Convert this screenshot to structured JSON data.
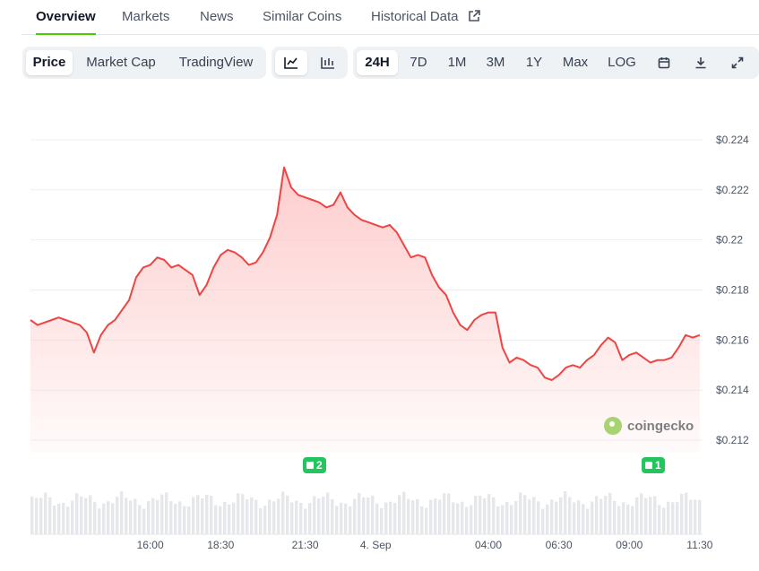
{
  "tabs": [
    {
      "label": "Overview",
      "active": true
    },
    {
      "label": "Markets"
    },
    {
      "label": "News"
    },
    {
      "label": "Similar Coins"
    },
    {
      "label": "Historical Data",
      "external": true
    }
  ],
  "toolbar": {
    "metric_tabs": [
      "Price",
      "Market Cap",
      "TradingView"
    ],
    "metric_selected": "Price",
    "chart_types": [
      "line-chart-icon",
      "candlestick-icon"
    ],
    "chart_type_selected": "line-chart-icon",
    "ranges": [
      "24H",
      "7D",
      "1M",
      "3M",
      "1Y",
      "Max",
      "LOG"
    ],
    "range_selected": "24H",
    "icons": [
      "calendar-icon",
      "download-icon",
      "fullscreen-icon"
    ]
  },
  "colors": {
    "line": "#ef4444",
    "fill_top": "#fecaca",
    "grid": "#eceff2",
    "badge": "#22c55e",
    "volume": "#e5e7eb",
    "accent": "#4bcc00"
  },
  "watermark": "coingecko",
  "badges": [
    {
      "count": "2",
      "time": "21:45"
    },
    {
      "count": "1",
      "time": "10:30"
    }
  ],
  "chart_data": {
    "type": "area",
    "title": "",
    "xlabel": "",
    "ylabel": "",
    "ylim": [
      0.2115,
      0.2245
    ],
    "y_ticks": [
      "$0.224",
      "$0.222",
      "$0.22",
      "$0.218",
      "$0.216",
      "$0.214",
      "$0.212"
    ],
    "y_tick_values": [
      0.224,
      0.222,
      0.22,
      0.218,
      0.216,
      0.214,
      0.212
    ],
    "x_ticks": [
      "16:00",
      "18:30",
      "21:30",
      "4. Sep",
      "04:00",
      "06:30",
      "09:00",
      "11:30"
    ],
    "x_tick_hours": [
      16,
      18.5,
      21.5,
      24,
      28,
      30.5,
      33,
      35.5
    ],
    "x_range_hours": [
      11.75,
      35.6
    ],
    "series": [
      {
        "hours": [
          11.75,
          12.0,
          12.25,
          12.5,
          12.75,
          13.0,
          13.25,
          13.5,
          13.75,
          14.0,
          14.25,
          14.5,
          14.75,
          15.0,
          15.25,
          15.5,
          15.75,
          16.0,
          16.25,
          16.5,
          16.75,
          17.0,
          17.25,
          17.5,
          17.75,
          18.0,
          18.25,
          18.5,
          18.75,
          19.0,
          19.25,
          19.5,
          19.75,
          20.0,
          20.25,
          20.5,
          20.75,
          21.0,
          21.25,
          21.5,
          21.75,
          22.0,
          22.25,
          22.5,
          22.75,
          23.0,
          23.25,
          23.5,
          23.75,
          24.0,
          24.25,
          24.5,
          24.75,
          25.0,
          25.25,
          25.5,
          25.75,
          26.0,
          26.25,
          26.5,
          26.75,
          27.0,
          27.25,
          27.5,
          27.75,
          28.0,
          28.25,
          28.5,
          28.75,
          29.0,
          29.25,
          29.5,
          29.75,
          30.0,
          30.25,
          30.5,
          30.75,
          31.0,
          31.25,
          31.5,
          31.75,
          32.0,
          32.25,
          32.5,
          32.75,
          33.0,
          33.25,
          33.5,
          33.75,
          34.0,
          34.25,
          34.5,
          34.75,
          35.0,
          35.25,
          35.5
        ],
        "values": [
          0.2168,
          0.2166,
          0.2167,
          0.2168,
          0.2169,
          0.2168,
          0.2167,
          0.2166,
          0.2163,
          0.2155,
          0.2162,
          0.2166,
          0.2168,
          0.2172,
          0.2176,
          0.2185,
          0.2189,
          0.219,
          0.2193,
          0.2192,
          0.2189,
          0.219,
          0.2188,
          0.2186,
          0.2178,
          0.2182,
          0.2189,
          0.2194,
          0.2196,
          0.2195,
          0.2193,
          0.219,
          0.2191,
          0.2195,
          0.2201,
          0.221,
          0.2229,
          0.2221,
          0.2218,
          0.2217,
          0.2216,
          0.2215,
          0.2213,
          0.2214,
          0.2219,
          0.2213,
          0.221,
          0.2208,
          0.2207,
          0.2206,
          0.2205,
          0.2206,
          0.2203,
          0.2198,
          0.2193,
          0.2194,
          0.2193,
          0.2186,
          0.2181,
          0.2178,
          0.2171,
          0.2166,
          0.2164,
          0.2168,
          0.217,
          0.2171,
          0.2171,
          0.2157,
          0.2151,
          0.2153,
          0.2152,
          0.215,
          0.2149,
          0.2145,
          0.2144,
          0.2146,
          0.2149,
          0.215,
          0.2149,
          0.2152,
          0.2154,
          0.2158,
          0.2161,
          0.2159,
          0.2152,
          0.2154,
          0.2155,
          0.2153,
          0.2151,
          0.2152,
          0.2152,
          0.2153,
          0.2157,
          0.2162,
          0.2161,
          0.2162
        ]
      }
    ]
  }
}
